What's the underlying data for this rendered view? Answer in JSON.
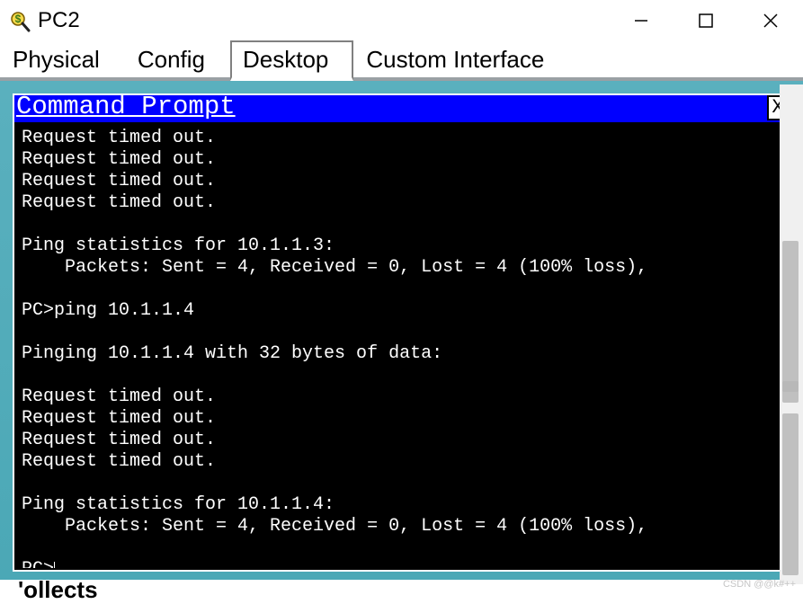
{
  "window": {
    "title": "PC2",
    "controls": {
      "min": "—",
      "max": "☐",
      "close": "✕"
    }
  },
  "tabs": [
    {
      "label": "Physical",
      "active": false
    },
    {
      "label": "Config",
      "active": false
    },
    {
      "label": "Desktop",
      "active": true
    },
    {
      "label": "Custom Interface",
      "active": false
    }
  ],
  "cmdprompt": {
    "title": "Command Prompt",
    "close_label": "X",
    "output": "Request timed out.\nRequest timed out.\nRequest timed out.\nRequest timed out.\n\nPing statistics for 10.1.1.3:\n    Packets: Sent = 4, Received = 0, Lost = 4 (100% loss),\n\nPC>ping 10.1.1.4\n\nPinging 10.1.1.4 with 32 bytes of data:\n\nRequest timed out.\nRequest timed out.\nRequest timed out.\nRequest timed out.\n\nPing statistics for 10.1.1.4:\n    Packets: Sent = 4, Received = 0, Lost = 4 (100% loss),\n\nPC>"
  },
  "watermark": "CSDN @@k#++",
  "cutoff_text": "'ollects"
}
